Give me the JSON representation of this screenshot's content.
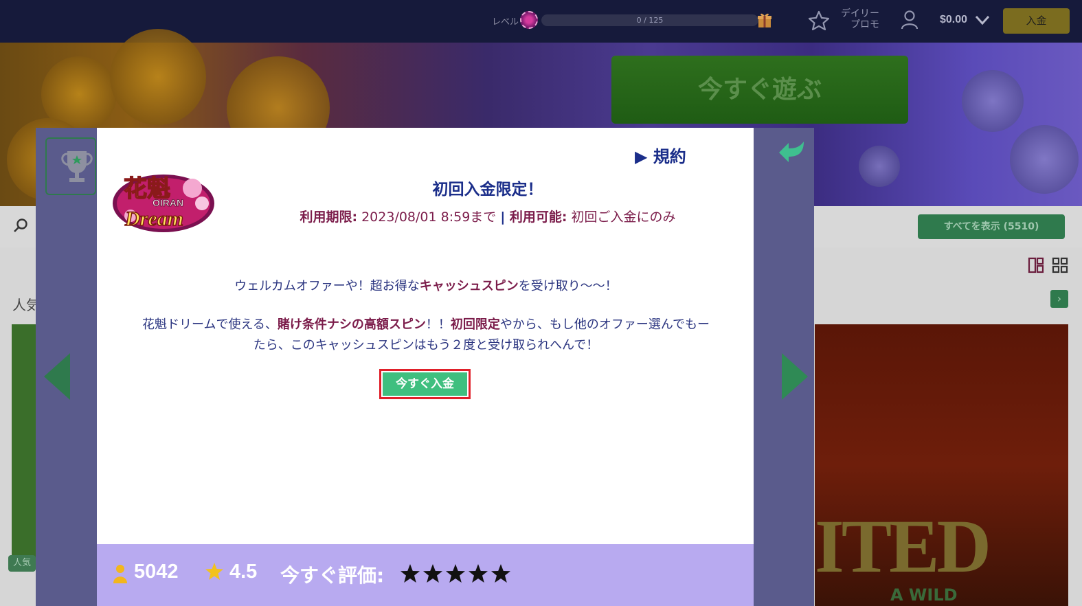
{
  "topbar": {
    "level_label": "レベル",
    "progress_text": "0 / 125",
    "progress_fraction": 0.0,
    "daily_promo_line1": "デイリー",
    "daily_promo_line2": "プロモ",
    "balance": "$0.00",
    "deposit_label": "入金"
  },
  "banner": {
    "play_now_label": "今すぐ遊ぶ"
  },
  "games_section": {
    "show_all_label": "すべてを表示 (5510)",
    "popular_heading": "人気",
    "popular_badge": "人気"
  },
  "modal": {
    "terms_link": "▶ 規約",
    "title": "初回入金限定！",
    "validity_label": "利用期限:",
    "validity_value": " 2023/08/01 8:59まで ",
    "separator": "|",
    "usable_label": " 利用可能:",
    "usable_value": " 初回ご入金にのみ",
    "desc1_a": "ウェルカムオファーや！超お得な",
    "desc1_b": "キャッシュスピン",
    "desc1_c": "を受け取り～～！",
    "desc2_a": "花魁ドリームで使える、",
    "desc2_b": "賭け条件ナシの高額スピン",
    "desc2_c": "！！",
    "desc2_d": "初回限定",
    "desc2_e": "やから、もし他のオファー選んでもー",
    "desc2_f": "たら、このキャッシュスピンはもう２度と受け取られへんで！",
    "deposit_now_label": "今すぐ入金",
    "logo_text_top": "花魁",
    "logo_text_mid": "OIRAN",
    "logo_text_bottom": "Dream"
  },
  "rating": {
    "user_count": "5042",
    "score": "4.5",
    "rate_now_label": "今すぐ評価:",
    "stars": 5
  },
  "colors": {
    "nav_bg": "#161a3b",
    "accent_green": "#3fbf7f",
    "title_blue": "#1b2e8a",
    "highlight_maroon": "#7b1c4a",
    "rating_bg": "#b8aaf0",
    "modal_frame": "#5a5b8c"
  }
}
